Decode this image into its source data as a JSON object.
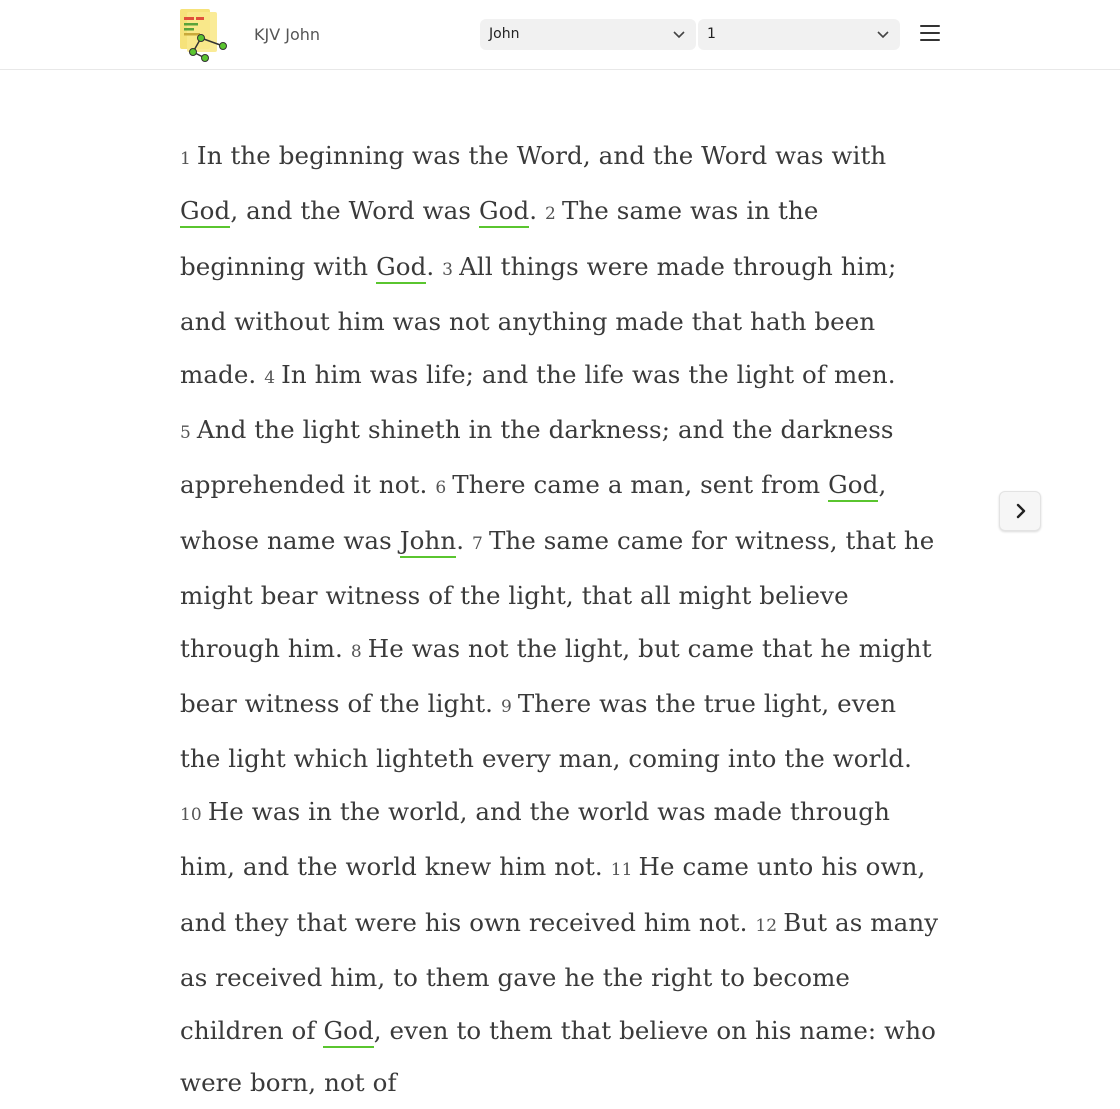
{
  "header": {
    "title": "KJV John",
    "book_select": {
      "value": "John"
    },
    "chapter_select": {
      "value": "1"
    },
    "menu_icon": "hamburger-menu-icon"
  },
  "nav": {
    "next_icon": "chevron-right-icon"
  },
  "colors": {
    "link_underline": "#5ac52f",
    "text": "#3a3a3a"
  },
  "passage": {
    "verses": [
      {
        "num": "1",
        "parts": [
          {
            "t": "In the beginning was the Word, and the Word was with "
          },
          {
            "t": "God",
            "link": true
          },
          {
            "t": ", and the Word was "
          },
          {
            "t": "God",
            "link": true
          },
          {
            "t": "."
          }
        ]
      },
      {
        "num": "2",
        "parts": [
          {
            "t": "The same was in the beginning with "
          },
          {
            "t": "God",
            "link": true
          },
          {
            "t": "."
          }
        ]
      },
      {
        "num": "3",
        "parts": [
          {
            "t": "All things were made through him; and without him was not anything made that hath been made."
          }
        ]
      },
      {
        "num": "4",
        "parts": [
          {
            "t": "In him was life; and the life was the light of men."
          }
        ]
      },
      {
        "num": "5",
        "parts": [
          {
            "t": "And the light shineth in the darkness; and the darkness apprehended it not."
          }
        ]
      },
      {
        "num": "6",
        "parts": [
          {
            "t": "There came a man, sent from "
          },
          {
            "t": "God",
            "link": true
          },
          {
            "t": ", whose name was "
          },
          {
            "t": "John",
            "link": true
          },
          {
            "t": "."
          }
        ]
      },
      {
        "num": "7",
        "parts": [
          {
            "t": "The same came for witness, that he might bear witness of the light, that all might believe through him."
          }
        ]
      },
      {
        "num": "8",
        "parts": [
          {
            "t": "He was not the light, but came that he might bear witness of the light."
          }
        ]
      },
      {
        "num": "9",
        "parts": [
          {
            "t": "There was the true light, even the light which lighteth every man, coming into the world."
          }
        ]
      },
      {
        "num": "10",
        "parts": [
          {
            "t": "He was in the world, and the world was made through him, and the world knew him not."
          }
        ]
      },
      {
        "num": "11",
        "parts": [
          {
            "t": "He came unto his own, and they that were his own received him not."
          }
        ]
      },
      {
        "num": "12",
        "parts": [
          {
            "t": "But as many as received him, to them gave he the right to become children of "
          },
          {
            "t": "God",
            "link": true
          },
          {
            "t": ", even to them that believe on his name: who were born, not of"
          }
        ]
      }
    ]
  }
}
